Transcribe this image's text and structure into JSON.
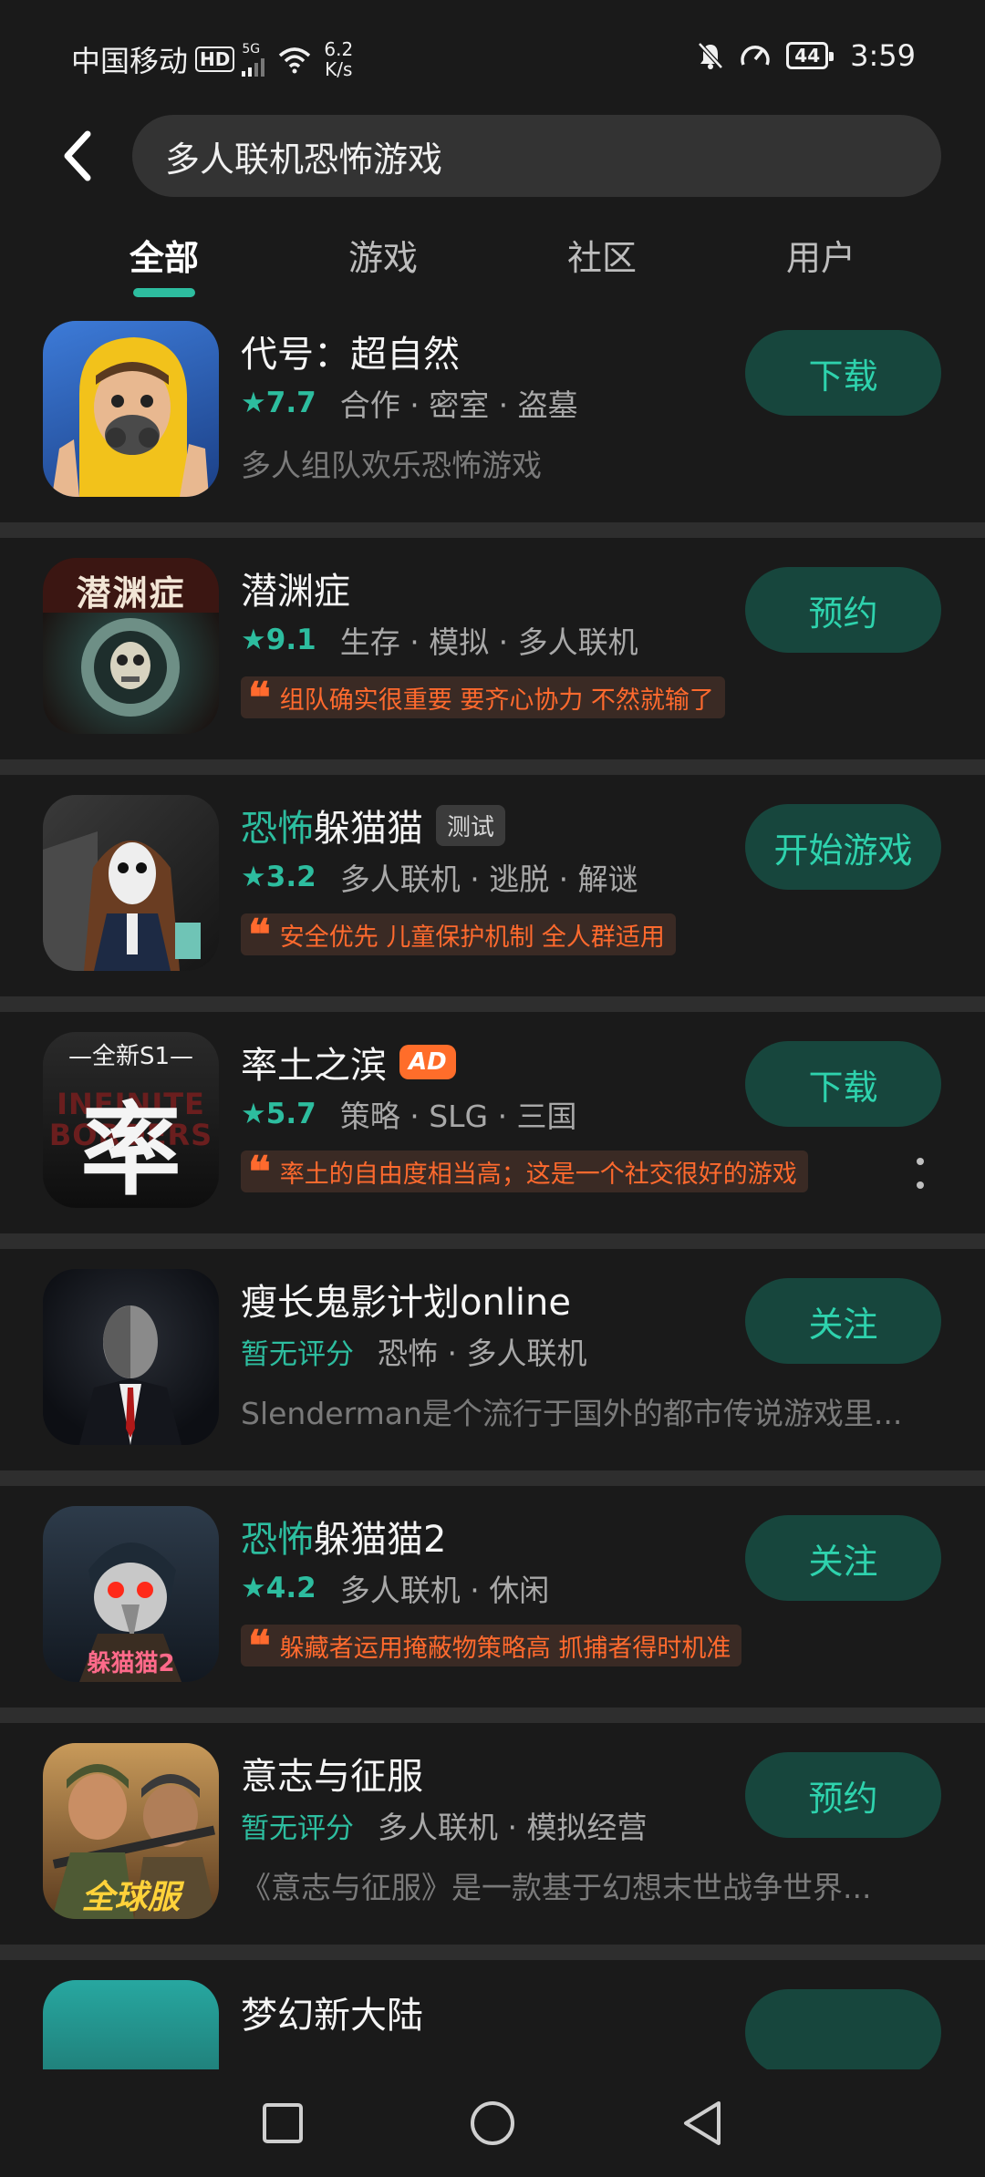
{
  "status_bar": {
    "carrier": "中国移动",
    "hd": "HD",
    "net_type": "5G",
    "speed_value": "6.2",
    "speed_unit": "K/s",
    "battery": "44",
    "time": "3:59"
  },
  "search": {
    "query": "多人联机恐怖游戏"
  },
  "tabs": [
    {
      "label": "全部",
      "active": true
    },
    {
      "label": "游戏"
    },
    {
      "label": "社区"
    },
    {
      "label": "用户"
    }
  ],
  "items": [
    {
      "name": "代号：超自然",
      "rating": "7.7",
      "tags": "合作 · 密室 · 盗墓",
      "desc": "多人组队欢乐恐怖游戏",
      "button": "下载",
      "icon": "hazmat-character-icon"
    },
    {
      "name": "潜渊症",
      "rating": "9.1",
      "tags": "生存 · 模拟 · 多人联机",
      "quote": "组队确实很重要 要齐心协力 不然就输了",
      "button": "预约",
      "icon": "diver-skull-icon",
      "icon_text": "潜渊症"
    },
    {
      "name_highlight": "恐怖",
      "name_rest": "躲猫猫",
      "badge": "测试",
      "rating": "3.2",
      "tags": "多人联机 · 逃脱 · 解谜",
      "quote": "安全优先 儿童保护机制 全人群适用",
      "button": "开始游戏",
      "icon": "masked-girl-icon"
    },
    {
      "name": "率土之滨",
      "badge": "AD",
      "rating": "5.7",
      "tags": "策略 · SLG · 三国",
      "quote": "率土的自由度相当高；这是一个社交很好的游戏",
      "button": "下载",
      "icon": "infinite-borders-icon",
      "icon_text_top": "—全新S1—",
      "icon_text_big": "率"
    },
    {
      "name": "瘦长鬼影计划online",
      "rating_text": "暂无评分",
      "tags": "恐怖 · 多人联机",
      "desc": "Slenderman是个流行于国外的都市传说游戏里...",
      "button": "关注",
      "icon": "slenderman-icon"
    },
    {
      "name_highlight": "恐怖",
      "name_rest": "躲猫猫2",
      "rating": "4.2",
      "tags": "多人联机 · 休闲",
      "quote": "躲藏者运用掩蔽物策略高 抓捕者得时机准",
      "button": "关注",
      "icon": "plague-doctor-icon",
      "icon_text": "躲猫猫2"
    },
    {
      "name": "意志与征服",
      "rating_text": "暂无评分",
      "tags": "多人联机 · 模拟经营",
      "desc": "《意志与征服》是一款基于幻想末世战争世界...",
      "button": "预约",
      "icon": "soldiers-icon",
      "icon_text": "全球服"
    },
    {
      "name": "梦幻新大陆",
      "button": "",
      "icon": "partial-icon"
    }
  ],
  "colors": {
    "accent": "#2dbd9f",
    "quote": "#ff6a2e",
    "button_bg": "#17463d"
  }
}
